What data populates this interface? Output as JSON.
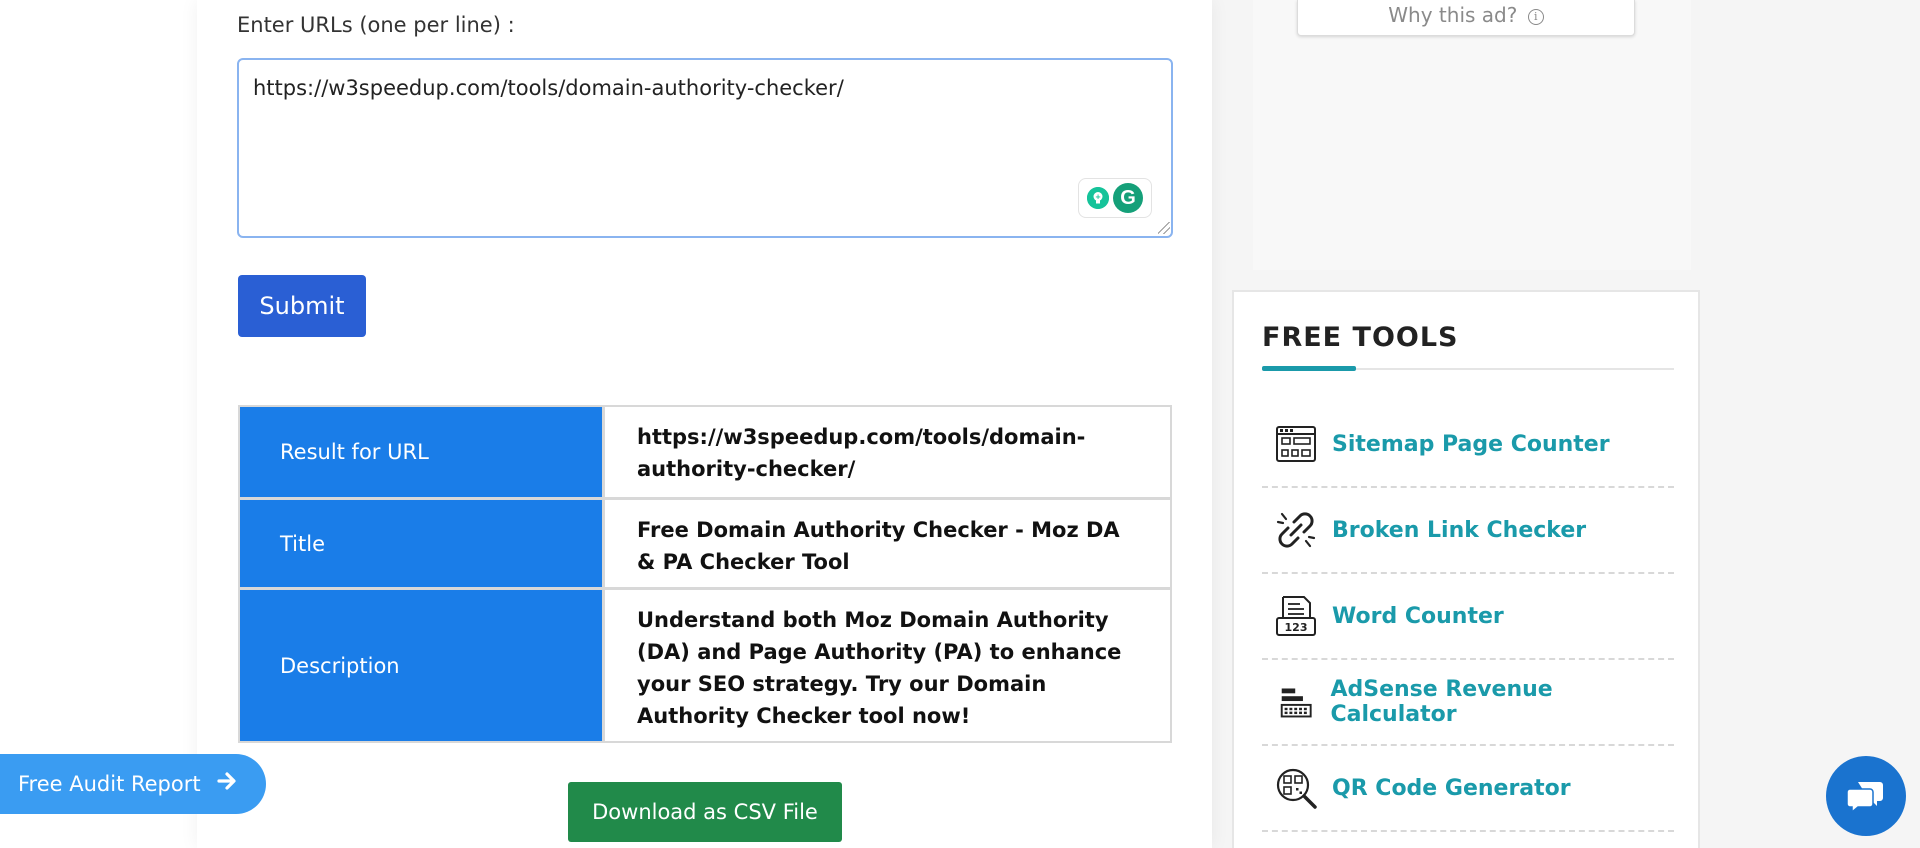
{
  "ad": {
    "why_this_ad": "Why this ad?",
    "info_glyph": "i"
  },
  "form": {
    "url_label": "Enter URLs (one per line) :",
    "url_value": "https://w3speedup.com/tools/domain-authority-checker/",
    "submit_label": "Submit",
    "grammarly_logo": "G"
  },
  "results": {
    "rows": [
      {
        "header": "Result for URL",
        "value": "https://w3speedup.com/tools/domain-authority-checker/"
      },
      {
        "header": "Title",
        "value": "Free Domain Authority Checker - Moz DA & PA Checker Tool"
      },
      {
        "header": "Description",
        "value": "Understand both Moz Domain Authority (DA) and Page Authority (PA) to enhance your SEO strategy. Try our Domain Authority Checker tool now!"
      }
    ],
    "download_label": "Download as CSV File"
  },
  "audit": {
    "label": "Free Audit Report",
    "icon": "arrow-right-icon"
  },
  "sidebar": {
    "title": "FREE TOOLS",
    "tools": [
      {
        "label": "Sitemap Page Counter",
        "icon": "sitemap-icon"
      },
      {
        "label": "Broken Link Checker",
        "icon": "broken-link-icon"
      },
      {
        "label": "Word Counter",
        "icon": "word-counter-icon"
      },
      {
        "label": "AdSense Revenue Calculator",
        "icon": "calculator-icon"
      },
      {
        "label": "QR Code Generator",
        "icon": "qr-code-icon"
      }
    ]
  },
  "colors": {
    "primary_blue": "#1a7de8",
    "submit_blue": "#2a5fd4",
    "csv_green": "#218a4a",
    "tool_teal": "#1a9aaa",
    "chat_blue": "#1a73cf"
  }
}
